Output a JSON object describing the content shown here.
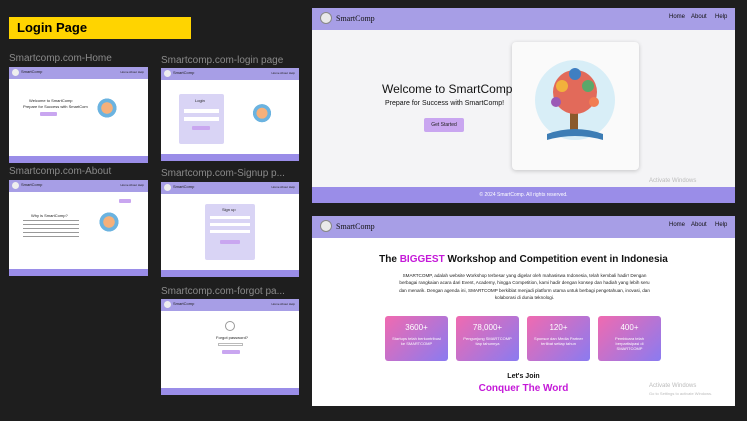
{
  "page_title": "Login Page",
  "frames": {
    "home": "Smartcomp.com-Home",
    "login": "Smartcomp.com-login page",
    "about": "Smartcomp.com-About",
    "signup": "Smartcomp.com-Signup p...",
    "forgot": "Smartcomp.com-forgot pa..."
  },
  "thumb": {
    "brand": "SmartComp",
    "links": "Home  About  Help",
    "welcome": "Welcome to SmartComp",
    "welcome_sub": "Prepare for Success with SmartComp!",
    "login_title": "Login",
    "about_title": "Why is SmartComp?",
    "signup_title": "Sign up",
    "forgot_title": "Forgot password?"
  },
  "home": {
    "brand": "SmartComp",
    "nav": [
      "Home",
      "About",
      "Help"
    ],
    "heading": "Welcome to SmartComp",
    "sub": "Prepare for Success with SmartComp!",
    "cta": "Get Started",
    "footer": "© 2024 SmartComp. All rights reserved."
  },
  "about": {
    "brand": "SmartComp",
    "nav": [
      "Home",
      "About",
      "Help"
    ],
    "h_pre": "The ",
    "h_strong": "BIGGEST",
    "h_post": " Workshop and Competition event in Indonesia",
    "body": "SMARTCOMP, adalah website Workshop terbesar yang digelar oleh mahasiswa Indonesia, telah kembali hadir! Dengan berbagai rangkaian acara dari Event, Academy, hingga Competition, kami hadir dengan konsep dan hadiah yang lebih seru dan menarik. Dengan agenda ini, SMARTCOMP berkiblat menjadi platform utama untuk berbagi pengetahuan, inovasi, dan kolaborasi di dunia teknologi.",
    "stats": [
      {
        "n": "3600+",
        "d": "Startups telah berkontribusi ke SMARTCOMP"
      },
      {
        "n": "78,000+",
        "d": "Pengunjung SMARTCOMP tiap tahunnya"
      },
      {
        "n": "120+",
        "d": "Sponsor dan Media Partner terlibat setiap tahun"
      },
      {
        "n": "400+",
        "d": "Pembicara telah berpartisipasi di SMARTCOMP"
      }
    ],
    "join": "Let's Join",
    "conquer": "Conquer The Word"
  },
  "watermark": {
    "title": "Activate Windows",
    "sub": "Go to Settings to activate Windows."
  },
  "colors": {
    "nav": "#a79ee6",
    "accent": "#c418d8",
    "yellow": "#ffd400"
  }
}
